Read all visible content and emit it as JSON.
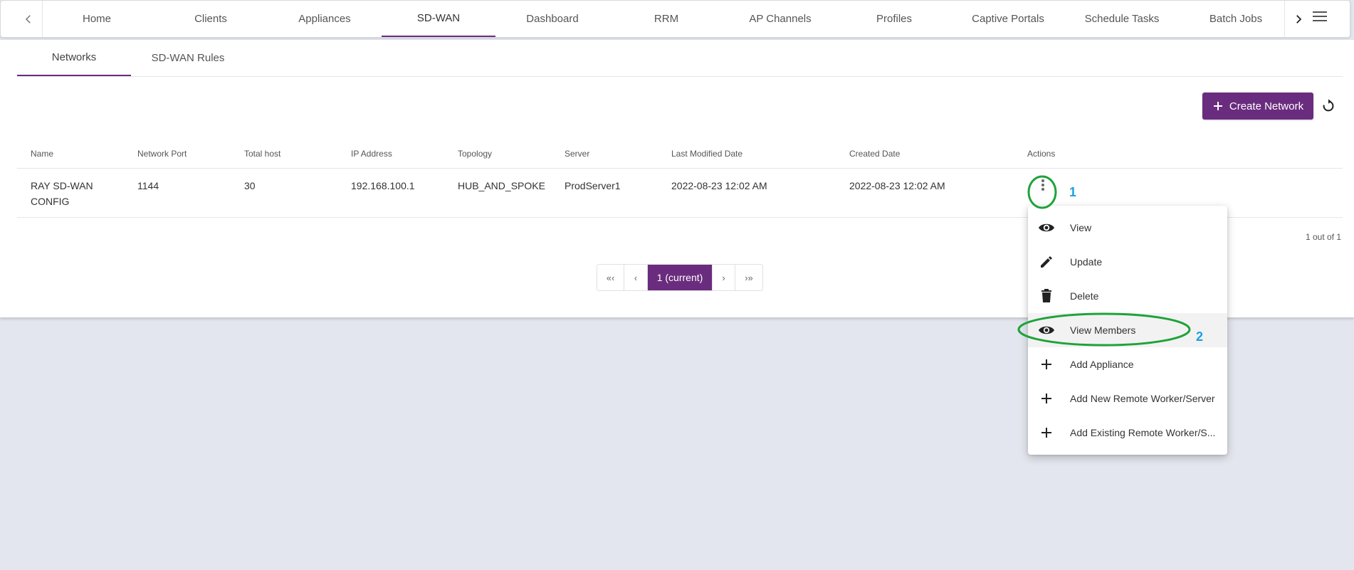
{
  "top_nav": {
    "tabs": [
      {
        "label": "Home"
      },
      {
        "label": "Clients"
      },
      {
        "label": "Appliances"
      },
      {
        "label": "SD-WAN",
        "active": true
      },
      {
        "label": "Dashboard"
      },
      {
        "label": "RRM"
      },
      {
        "label": "AP Channels"
      },
      {
        "label": "Profiles"
      },
      {
        "label": "Captive Portals"
      },
      {
        "label": "Schedule Tasks"
      },
      {
        "label": "Batch Jobs"
      }
    ],
    "left_arrow_icon": "chevron-left-icon",
    "right_arrow_icon": "chevron-right-icon",
    "menu_icon": "hamburger-menu-icon"
  },
  "sub_tabs": [
    {
      "label": "Networks",
      "active": true
    },
    {
      "label": "SD-WAN Rules"
    }
  ],
  "toolbar": {
    "create_label": "Create Network",
    "create_icon": "plus-icon",
    "refresh_icon": "refresh-icon"
  },
  "table": {
    "headers": [
      "Name",
      "Network Port",
      "Total host",
      "IP Address",
      "Topology",
      "Server",
      "Last Modified Date",
      "Created Date",
      "Actions"
    ],
    "rows": [
      {
        "name": "RAY SD-WAN CONFIG",
        "network_port": "1144",
        "total_host": "30",
        "ip_address": "192.168.100.1",
        "topology": "HUB_AND_SPOKE",
        "server": "ProdServer1",
        "last_modified": "2022-08-23 12:02 AM",
        "created": "2022-08-23 12:02 AM"
      }
    ],
    "count_text": "1 out of 1"
  },
  "pagination": {
    "first": "«‹",
    "prev": "‹",
    "current": "1 (current)",
    "next": "›",
    "last": "›»"
  },
  "actions_menu": {
    "items": [
      {
        "label": "View",
        "icon": "eye-icon"
      },
      {
        "label": "Update",
        "icon": "pencil-icon"
      },
      {
        "label": "Delete",
        "icon": "trash-icon"
      },
      {
        "label": "View Members",
        "icon": "eye-icon",
        "highlighted": true
      },
      {
        "label": "Add Appliance",
        "icon": "plus-icon"
      },
      {
        "label": "Add New Remote Worker/Server",
        "icon": "plus-icon"
      },
      {
        "label": "Add Existing Remote Worker/S...",
        "icon": "plus-icon"
      }
    ]
  },
  "annotations": {
    "step1": "1",
    "step2": "2",
    "circle_color": "#1ea33a",
    "number_color": "#1aa0e0"
  },
  "colors": {
    "brand": "#6a2c7e",
    "background": "#e3e6ee"
  }
}
